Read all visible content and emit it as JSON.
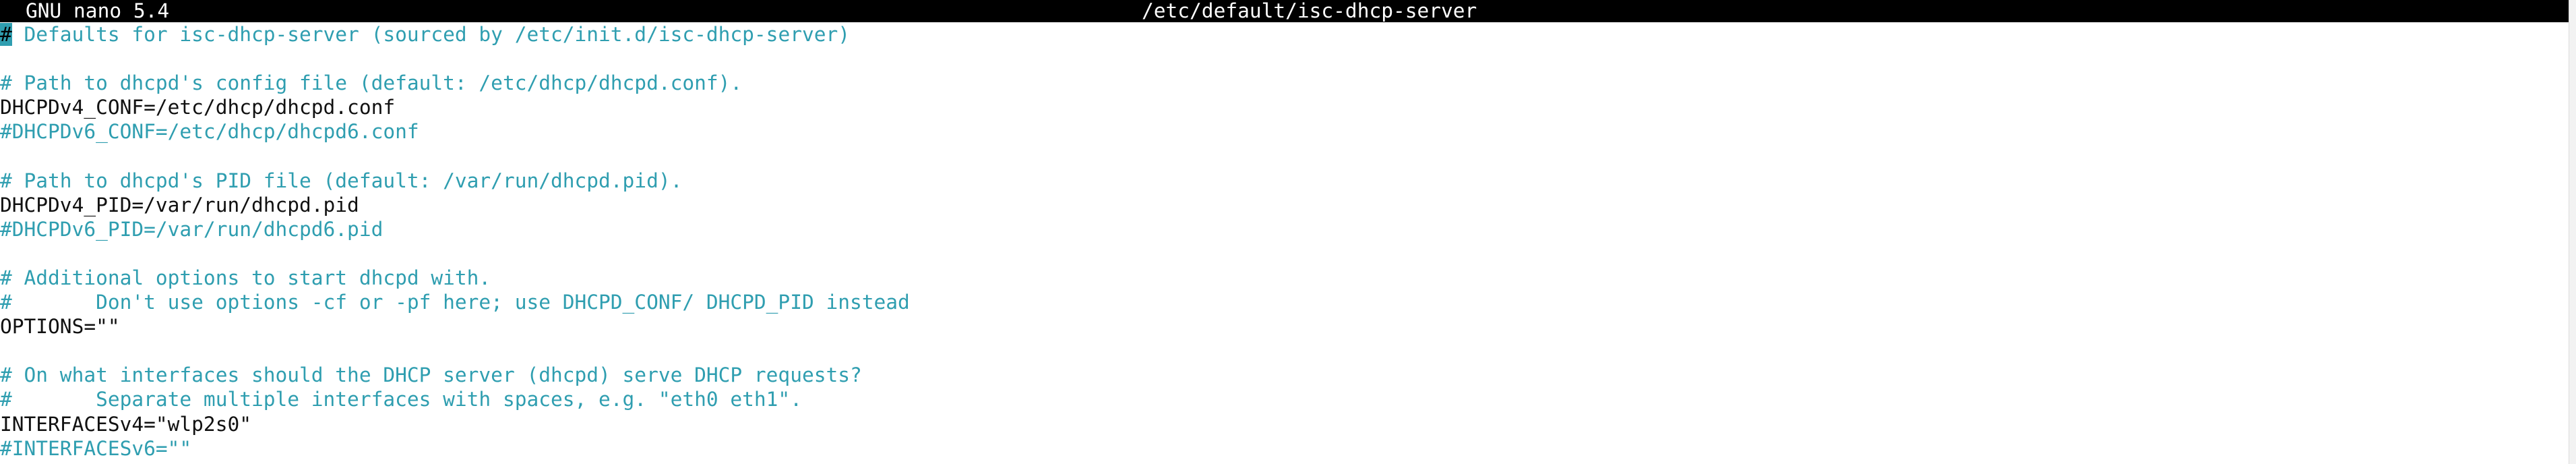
{
  "titlebar": {
    "app": "GNU nano 5.4",
    "filename": "/etc/default/isc-dhcp-server"
  },
  "editor": {
    "cursor_char": "#",
    "lines": [
      {
        "text": " Defaults for isc-dhcp-server (sourced by /etc/init.d/isc-dhcp-server)",
        "type": "comment"
      },
      {
        "text": "",
        "type": "blank"
      },
      {
        "text": "# Path to dhcpd's config file (default: /etc/dhcp/dhcpd.conf).",
        "type": "comment"
      },
      {
        "text": "DHCPDv4_CONF=/etc/dhcp/dhcpd.conf",
        "type": "code"
      },
      {
        "text": "#DHCPDv6_CONF=/etc/dhcp/dhcpd6.conf",
        "type": "comment"
      },
      {
        "text": "",
        "type": "blank"
      },
      {
        "text": "# Path to dhcpd's PID file (default: /var/run/dhcpd.pid).",
        "type": "comment"
      },
      {
        "text": "DHCPDv4_PID=/var/run/dhcpd.pid",
        "type": "code"
      },
      {
        "text": "#DHCPDv6_PID=/var/run/dhcpd6.pid",
        "type": "comment"
      },
      {
        "text": "",
        "type": "blank"
      },
      {
        "text": "# Additional options to start dhcpd with.",
        "type": "comment"
      },
      {
        "text": "#       Don't use options -cf or -pf here; use DHCPD_CONF/ DHCPD_PID instead",
        "type": "comment"
      },
      {
        "text": "OPTIONS=\"\"",
        "type": "code"
      },
      {
        "text": "",
        "type": "blank"
      },
      {
        "text": "# On what interfaces should the DHCP server (dhcpd) serve DHCP requests?",
        "type": "comment"
      },
      {
        "text": "#       Separate multiple interfaces with spaces, e.g. \"eth0 eth1\".",
        "type": "comment"
      },
      {
        "text": "INTERFACESv4=\"wlp2s0\"",
        "type": "code"
      },
      {
        "text": "#INTERFACESv6=\"\"",
        "type": "comment"
      }
    ]
  }
}
